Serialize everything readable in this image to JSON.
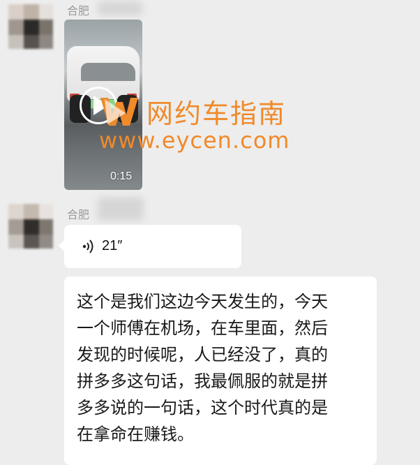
{
  "messages": [
    {
      "sender": "合肥",
      "type": "video",
      "video_duration": "0:15",
      "icons": [
        "play-icon"
      ]
    },
    {
      "sender": "合肥",
      "type": "voice",
      "voice_duration": "21″",
      "icons": [
        "voice-wave-icon"
      ]
    },
    {
      "type": "text",
      "lines": [
        "这个是我们这边今天发生的，今天",
        "一个师傅在机场，在车里面，然后",
        "发现的时候呢，人已经没了，真的",
        "拼多多这句话，我最佩服的就是拼",
        "多多说的一句话，这个时代真的是",
        "在拿命在赚钱。"
      ]
    }
  ],
  "watermark": {
    "title": "网约车指南",
    "url": "www.eycen.com",
    "color": "#f08a2a",
    "logo": "w-logo-icon"
  },
  "colors": {
    "background": "#ededed",
    "bubble": "#ffffff",
    "sender_name": "#9b9b9b"
  }
}
